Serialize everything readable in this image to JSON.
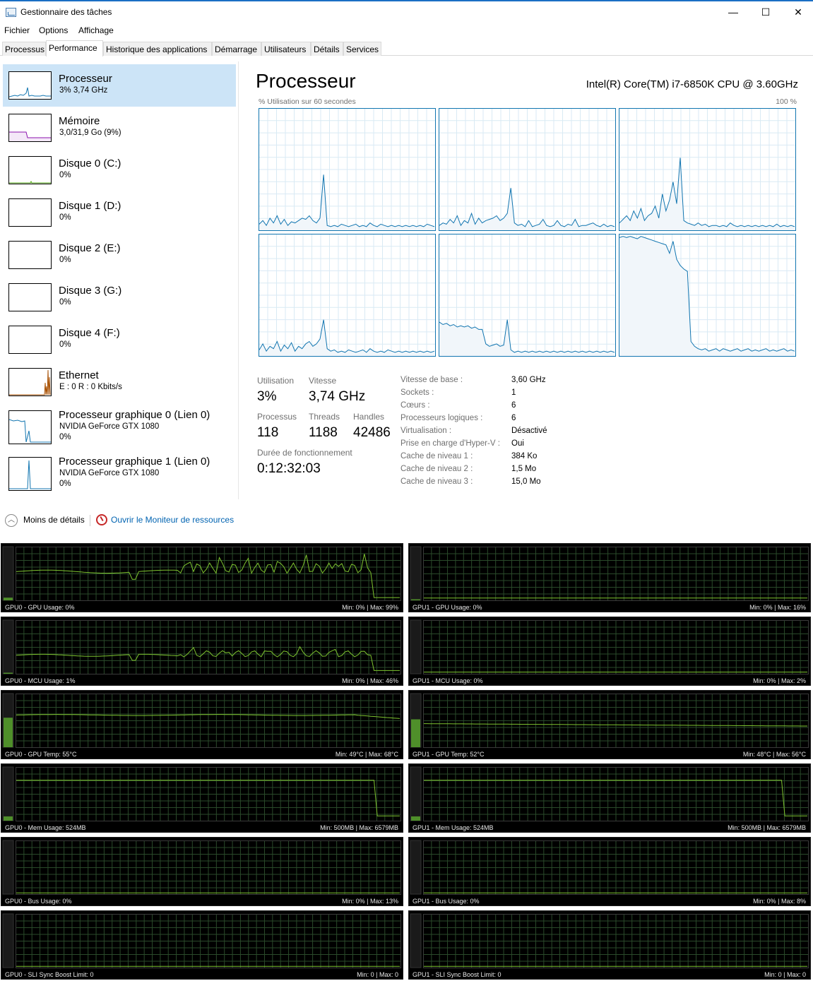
{
  "window": {
    "title": "Gestionnaire des tâches",
    "min_glyph": "—",
    "max_glyph": "☐",
    "close_glyph": "✕"
  },
  "menu": [
    "Fichier",
    "Options",
    "Affichage"
  ],
  "tabs": [
    "Processus",
    "Performance",
    "Historique des applications",
    "Démarrage",
    "Utilisateurs",
    "Détails",
    "Services"
  ],
  "active_tab": "Performance",
  "sidebar": [
    {
      "name": "Processeur",
      "sub": "3% 3,74 GHz",
      "sub2": "",
      "color": "#1175b0",
      "fill": "#e8f2fb"
    },
    {
      "name": "Mémoire",
      "sub": "3,0/31,9 Go (9%)",
      "sub2": "",
      "color": "#8b12ae",
      "fill": "#f4e8f8"
    },
    {
      "name": "Disque 0 (C:)",
      "sub": "0%",
      "sub2": "",
      "color": "#4da60c",
      "fill": "#eef7e6"
    },
    {
      "name": "Disque 1 (D:)",
      "sub": "0%",
      "sub2": "",
      "color": "#4da60c",
      "fill": "#eef7e6"
    },
    {
      "name": "Disque 2 (E:)",
      "sub": "0%",
      "sub2": "",
      "color": "#4da60c",
      "fill": "#eef7e6"
    },
    {
      "name": "Disque 3 (G:)",
      "sub": "0%",
      "sub2": "",
      "color": "#4da60c",
      "fill": "#eef7e6"
    },
    {
      "name": "Disque 4 (F:)",
      "sub": "0%",
      "sub2": "",
      "color": "#4da60c",
      "fill": "#eef7e6"
    },
    {
      "name": "Ethernet",
      "sub": "E : 0 R : 0 Kbits/s",
      "sub2": "",
      "color": "#a74f01",
      "fill": "#fbeee2"
    },
    {
      "name": "Processeur graphique 0 (Lien 0)",
      "sub": "NVIDIA GeForce GTX 1080",
      "sub2": "0%",
      "color": "#1175b0",
      "fill": "#e8f2fb"
    },
    {
      "name": "Processeur graphique 1 (Lien 0)",
      "sub": "NVIDIA GeForce GTX 1080",
      "sub2": "0%",
      "color": "#1175b0",
      "fill": "#e8f2fb"
    }
  ],
  "main": {
    "title": "Processeur",
    "cpu_model": "Intel(R) Core(TM) i7-6850K CPU @ 3.60GHz",
    "axis_left": "% Utilisation sur 60 secondes",
    "axis_right": "100 %",
    "stats": {
      "utilisation_label": "Utilisation",
      "utilisation": "3%",
      "vitesse_label": "Vitesse",
      "vitesse": "3,74 GHz",
      "processus_label": "Processus",
      "processus": "118",
      "threads_label": "Threads",
      "threads": "1188",
      "handles_label": "Handles",
      "handles": "42486",
      "uptime_label": "Durée de fonctionnement",
      "uptime": "0:12:32:03"
    },
    "details": [
      {
        "key": "Vitesse de base :",
        "value": "3,60 GHz"
      },
      {
        "key": "Sockets :",
        "value": "1"
      },
      {
        "key": "Cœurs :",
        "value": "6"
      },
      {
        "key": "Processeurs logiques :",
        "value": "6"
      },
      {
        "key": "Virtualisation :",
        "value": "Désactivé"
      },
      {
        "key": "Prise en charge d'Hyper-V :",
        "value": "Oui"
      },
      {
        "key": "Cache de niveau 1 :",
        "value": "384 Ko"
      },
      {
        "key": "Cache de niveau 2 :",
        "value": "1,5 Mo"
      },
      {
        "key": "Cache de niveau 3 :",
        "value": "15,0 Mo"
      }
    ],
    "colors": {
      "line": "#1175b0",
      "fill": "#f1f6fa",
      "grid": "#d9eaf4",
      "border": "#1175b0"
    }
  },
  "footer": {
    "less_details": "Moins de détails",
    "resource_monitor": "Ouvrir le Moniteur de ressources"
  },
  "gpu_panels": [
    {
      "label": "GPU0 - GPU Usage: 0%",
      "minmax": "Min: 0% | Max: 99%"
    },
    {
      "label": "GPU1 - GPU Usage: 0%",
      "minmax": "Min: 0% | Max: 16%"
    },
    {
      "label": "GPU0 - MCU Usage: 1%",
      "minmax": "Min: 0% | Max: 46%"
    },
    {
      "label": "GPU1 - MCU Usage: 0%",
      "minmax": "Min: 0% | Max: 2%"
    },
    {
      "label": "GPU0 - GPU Temp: 55°C",
      "minmax": "Min: 49°C | Max: 68°C"
    },
    {
      "label": "GPU1 - GPU Temp: 52°C",
      "minmax": "Min: 48°C | Max: 56°C"
    },
    {
      "label": "GPU0 - Mem Usage: 524MB",
      "minmax": "Min: 500MB | Max: 6579MB"
    },
    {
      "label": "GPU1 - Mem Usage: 524MB",
      "minmax": "Min: 500MB | Max: 6579MB"
    },
    {
      "label": "GPU0 - Bus Usage: 0%",
      "minmax": "Min: 0% | Max: 13%"
    },
    {
      "label": "GPU1 - Bus Usage: 0%",
      "minmax": "Min: 0% | Max: 8%"
    },
    {
      "label": "GPU0 - SLI Sync Boost Limit: 0",
      "minmax": "Min: 0 | Max: 0"
    },
    {
      "label": "GPU1 - SLI Sync Boost Limit: 0",
      "minmax": "Min: 0 | Max: 0"
    }
  ],
  "gpu_colors": {
    "line": "#7ec42f",
    "grid": "#2a4a2a",
    "bg": "#000000",
    "bar": "#4f8f2a"
  }
}
